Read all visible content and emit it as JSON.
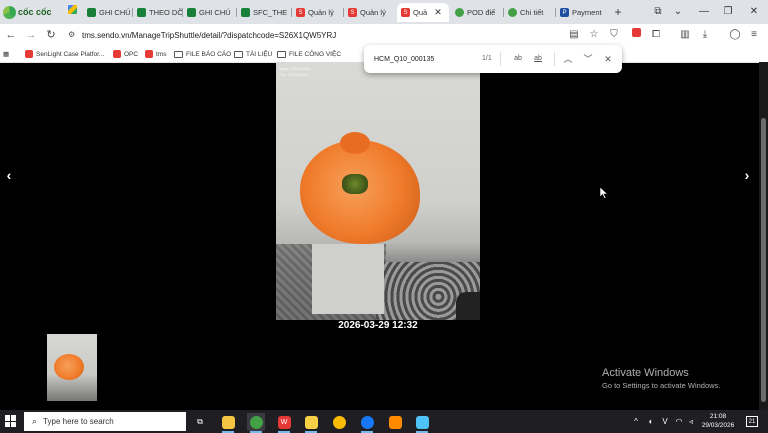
{
  "browser": {
    "brand": "cốc cốc",
    "tabs": [
      {
        "label": "GHI CHÚ",
        "icon": "sheets-icon"
      },
      {
        "label": "THEO DÕ",
        "icon": "sheets-icon"
      },
      {
        "label": "GHI CHÚ",
        "icon": "sheets-icon"
      },
      {
        "label": "SFC_THE",
        "icon": "sheets-icon"
      },
      {
        "label": "Quản lý",
        "icon": "sendo-icon"
      },
      {
        "label": "Quản lý",
        "icon": "sendo-icon"
      },
      {
        "label": "Quả",
        "icon": "sendo-icon"
      },
      {
        "label": "POD điể",
        "icon": "green-circle-icon"
      },
      {
        "label": "Chi tiết",
        "icon": "green-circle-icon"
      },
      {
        "label": "Payment",
        "icon": "payment-icon"
      }
    ],
    "active_tab_index": 6,
    "url": "tms.sendo.vn/ManageTripShuttle/detail/?dispatchcode=S26X1QW5YRJ",
    "bookmarks": [
      {
        "label": "SenLight Case Platfor...",
        "icon": "sendo-icon"
      },
      {
        "label": "OPC",
        "icon": "sendo-icon"
      },
      {
        "label": "tms",
        "icon": "sendo-icon"
      },
      {
        "label": "FILE BÁO CÁO",
        "icon": "folder-icon"
      },
      {
        "label": "TÀI LIỆU",
        "icon": "folder-icon"
      },
      {
        "label": "FILE CÔNG VIỆC",
        "icon": "folder-icon"
      }
    ],
    "find": {
      "query": "HCM_Q10_000135",
      "count": "1/1",
      "match_case_label": "ab",
      "whole_word_label": "ab"
    }
  },
  "viewer": {
    "photo_stamp_line1": "Ngày: 29/03/2026",
    "photo_stamp_line2": "Giờ: 29/03/2026",
    "caption": "2026-03-29 12:32",
    "prev_label": "‹",
    "next_label": "›"
  },
  "watermark": {
    "title": "Activate Windows",
    "subtitle": "Go to Settings to activate Windows."
  },
  "taskbar": {
    "search_placeholder": "Type here to search",
    "time": "21:08",
    "date": "29/03/2026",
    "notification_count": "21"
  }
}
